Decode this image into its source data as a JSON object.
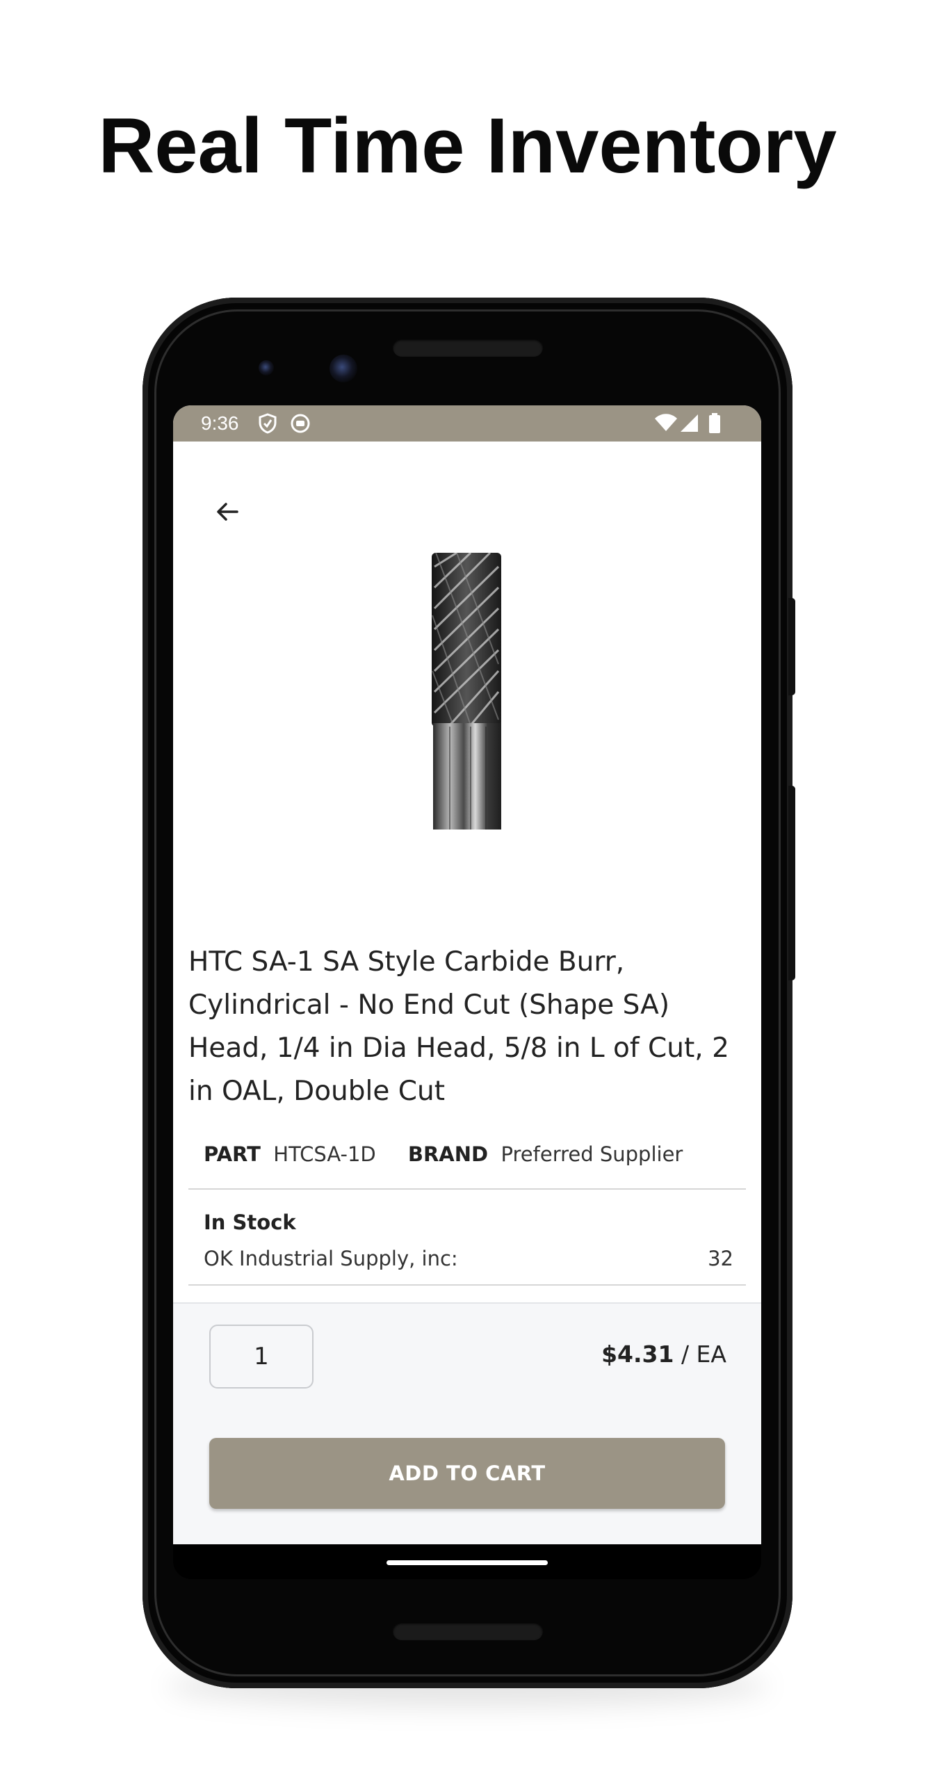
{
  "headline": "Real Time Inventory",
  "status_bar": {
    "time": "9:36",
    "icons": [
      "shield-icon",
      "circle-face-icon",
      "wifi-icon",
      "cell-signal-icon",
      "battery-icon"
    ]
  },
  "nav": {
    "back_icon": "arrow-left-icon"
  },
  "product": {
    "image": "carbide-burr",
    "title": "HTC SA-1 SA Style Carbide Burr, Cylindrical - No End Cut (Shape SA) Head, 1/4 in Dia Head, 5/8 in L of Cut, 2 in OAL, Double Cut",
    "part_label": "PART",
    "part_value": "HTCSA-1D",
    "brand_label": "BRAND",
    "brand_value": "Preferred Supplier"
  },
  "inventory": {
    "status": "In Stock",
    "location": "OK Industrial Supply, inc:",
    "quantity": "32"
  },
  "purchase": {
    "quantity_value": "1",
    "price": "$4.31",
    "unit": "/ EA",
    "add_to_cart_label": "ADD TO CART"
  },
  "colors": {
    "accent": "#9b9485",
    "panel": "#f6f7f9"
  }
}
